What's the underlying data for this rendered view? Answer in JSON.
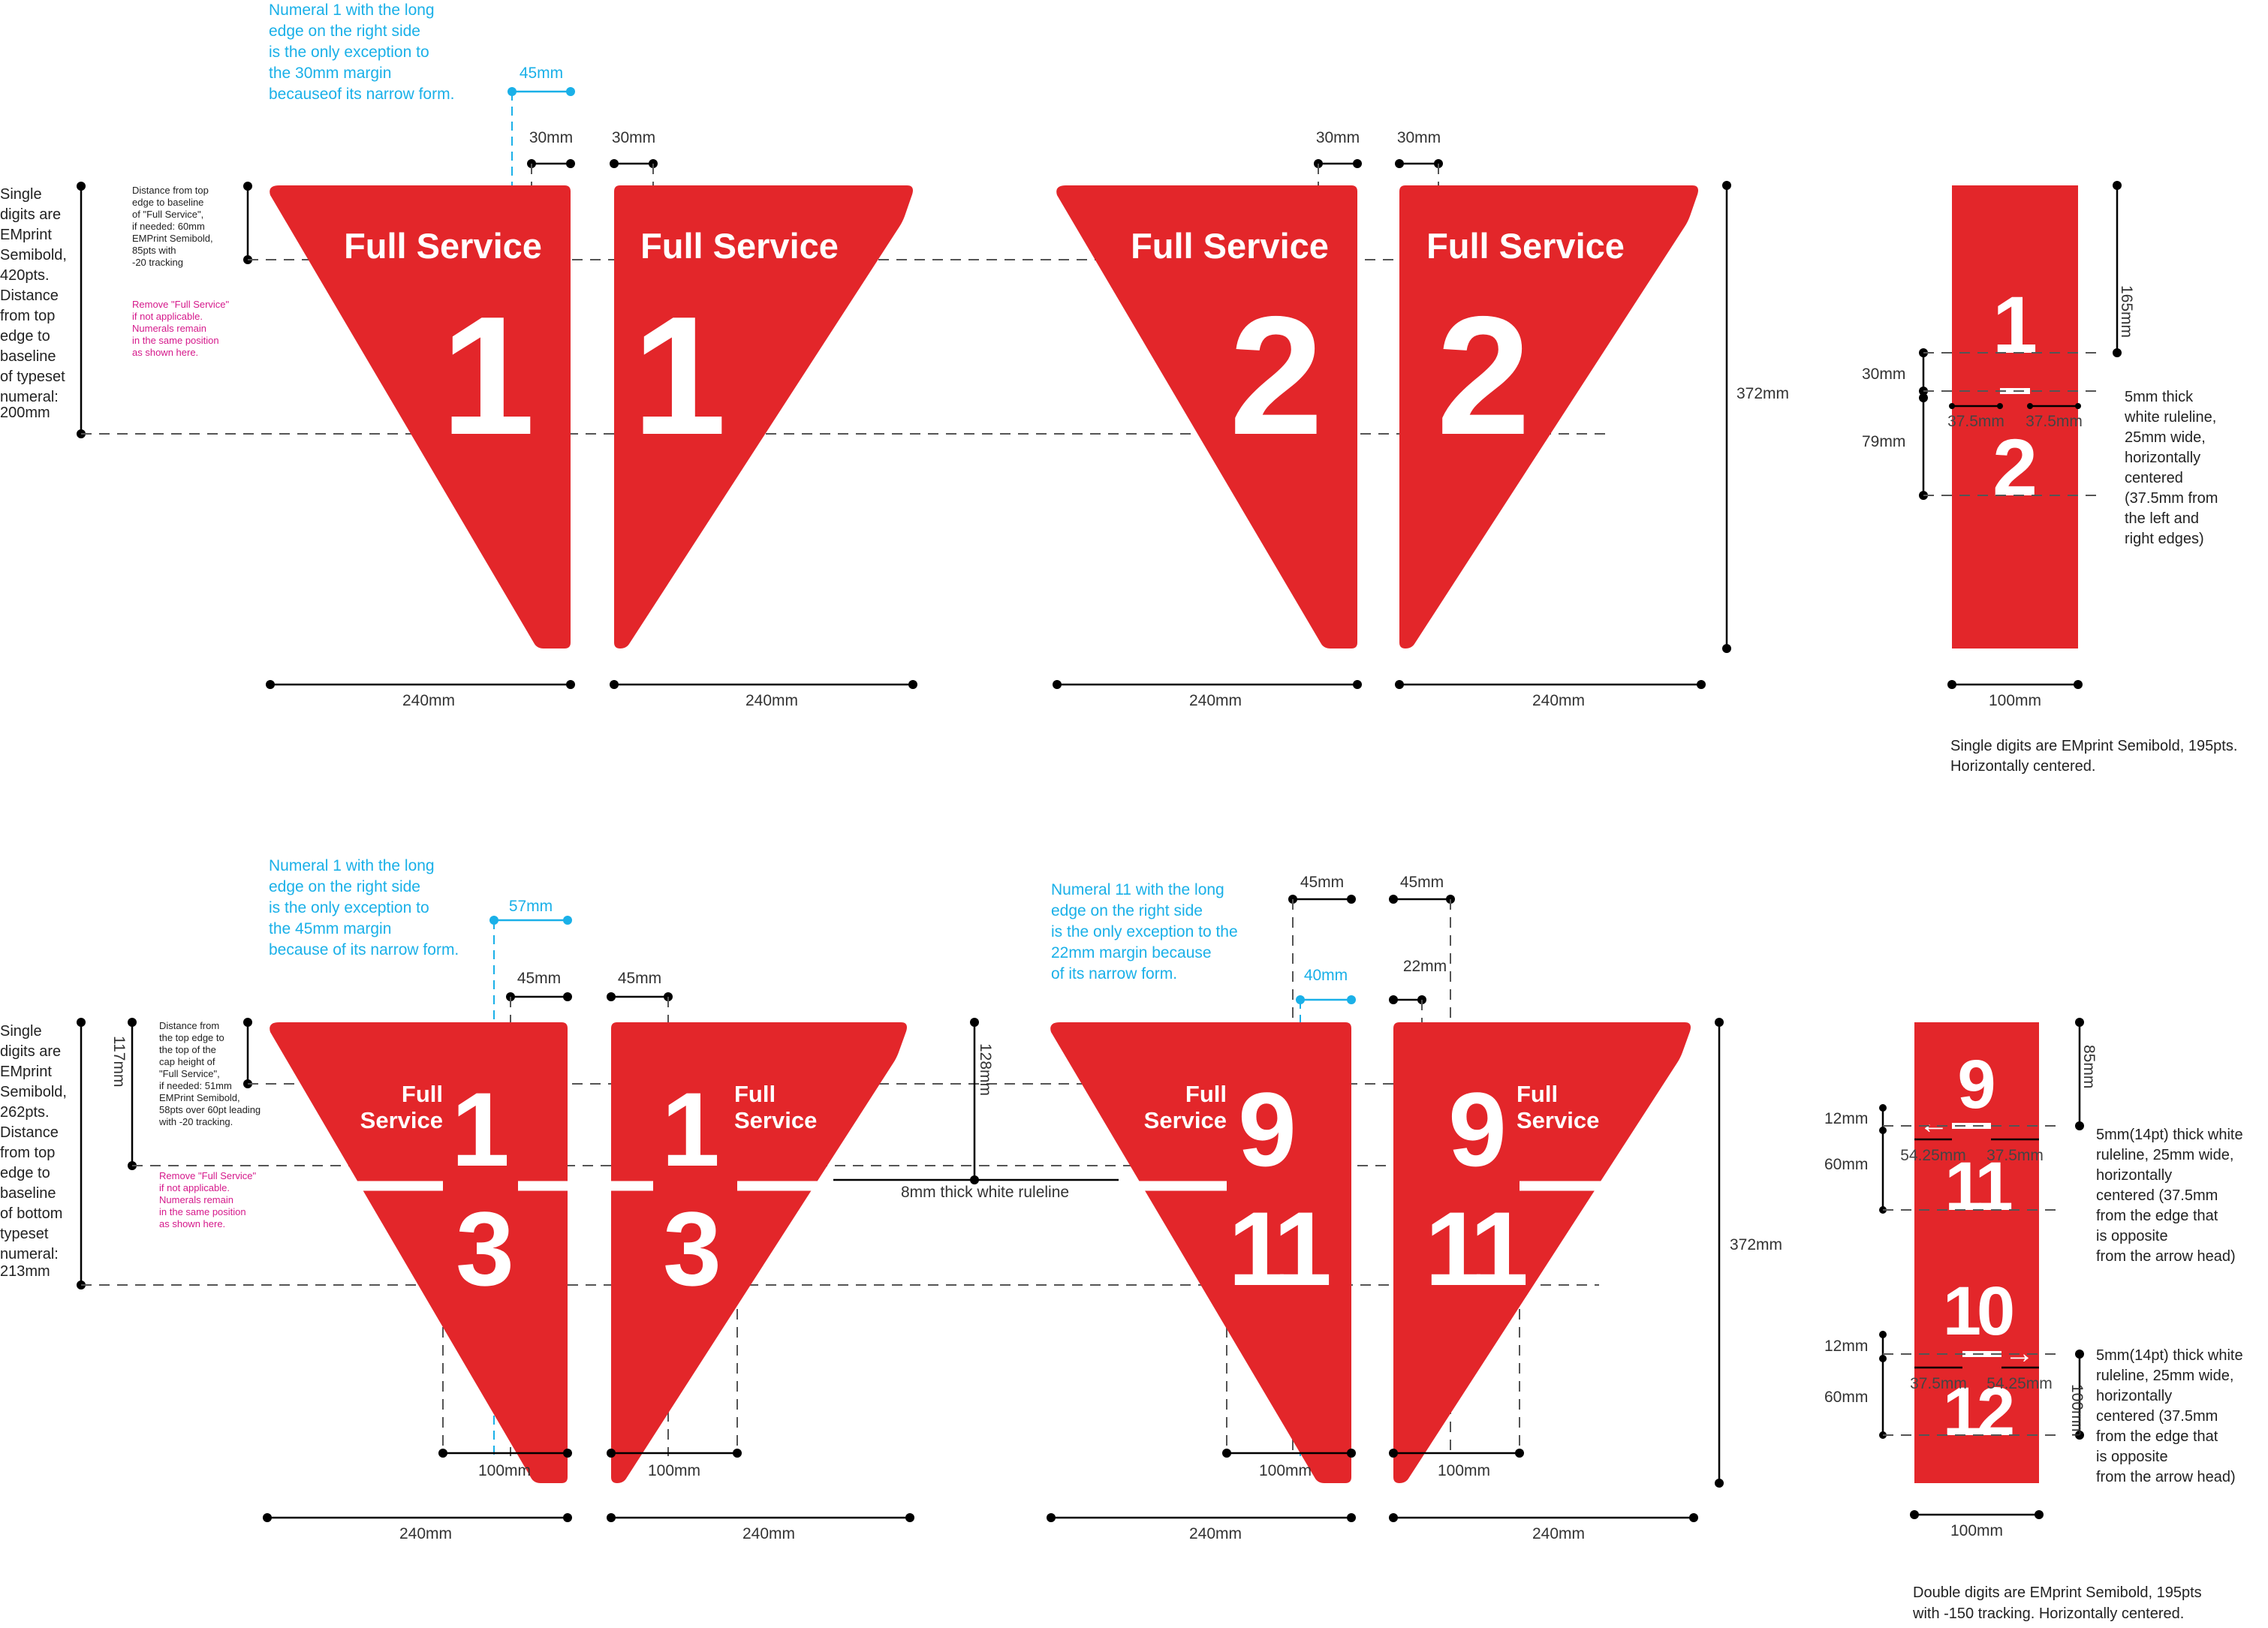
{
  "colors": {
    "sign_red": "#e3262a",
    "note_blue": "#1ab0e8",
    "note_magenta": "#d5198b",
    "dimension": "#000000"
  },
  "sign_text": "Full Service",
  "sign_text_line1": "Full",
  "sign_text_line2": "Service",
  "top": {
    "callout_exception": [
      "Numeral 1 with the long",
      "edge on the right side",
      "is the only exception to",
      "the 30mm margin",
      "becauseof its narrow form."
    ],
    "left_note": [
      "Single",
      "digits are",
      "EMprint",
      "Semibold,",
      "420pts.",
      "Distance",
      "from top",
      "edge to",
      "baseline",
      "of typeset",
      "numeral:",
      "200mm"
    ],
    "small_note": [
      "Distance from top",
      "edge to baseline",
      "of \"Full Service\",",
      "if needed: 60mm",
      "EMPrint Semibold,",
      "85pts with",
      "-20 tracking"
    ],
    "magenta_note": [
      "Remove \"Full Service\"",
      "if not applicable.",
      "Numerals remain",
      "in the same position",
      "as shown here."
    ],
    "numerals": [
      "1",
      "1",
      "2",
      "2"
    ],
    "dims": {
      "d45": "45mm",
      "d30": "30mm",
      "d240": "240mm",
      "d372": "372mm",
      "d165": "165mm",
      "d100": "100mm",
      "d79": "79mm",
      "d375": "37.5mm"
    },
    "fraction": {
      "num": "1",
      "den": "2"
    },
    "rule_note": [
      "5mm thick",
      "white ruleline,",
      "25mm wide,",
      "horizontally",
      "centered",
      "(37.5mm from",
      "the left and",
      "right edges)"
    ],
    "bottom_note": [
      "Single digits are EMprint Semibold, 195pts.",
      "Horizontally centered."
    ]
  },
  "bottom": {
    "callout_exception": [
      "Numeral 1 with the long",
      "edge on the right side",
      "is the only exception to",
      "the 45mm margin",
      "because of its narrow form."
    ],
    "callout_exception_11": [
      "Numeral 11 with the long",
      "edge on the right side",
      "is the only exception to the",
      "22mm margin because",
      "of its narrow form."
    ],
    "left_note": [
      "Single",
      "digits are",
      "EMprint",
      "Semibold,",
      "262pts.",
      "Distance",
      "from top",
      "edge to",
      "baseline",
      "of bottom",
      "typeset",
      "numeral:",
      "213mm"
    ],
    "small_note": [
      "Distance from",
      "the top edge to",
      "the top of the",
      "cap height of",
      "\"Full Service\",",
      "if needed: 51mm",
      "EMPrint Semibold,",
      "58pts over 60pt leading",
      "with -20 tracking."
    ],
    "magenta_note": [
      "Remove \"Full Service\"",
      "if not applicable.",
      "Numerals remain",
      "in the same position",
      "as shown here."
    ],
    "fractions": [
      {
        "num": "1",
        "den": "3"
      },
      {
        "num": "1",
        "den": "3"
      },
      {
        "num": "9",
        "den": "11"
      },
      {
        "num": "9",
        "den": "11"
      }
    ],
    "dims": {
      "d57": "57mm",
      "d45": "45mm",
      "d40": "40mm",
      "d22": "22mm",
      "d117": "117mm",
      "d128": "128mm",
      "d100": "100mm",
      "d240": "240mm",
      "d372": "372mm",
      "d85": "85mm",
      "d12": "12mm",
      "d60": "60mm",
      "d5425": "54.25mm",
      "d375": "37.5mm"
    },
    "ruleline_label": "8mm thick white ruleline",
    "strip_fractions": [
      {
        "num": "9",
        "den": "11",
        "arrow": "←"
      },
      {
        "num": "10",
        "den": "12",
        "arrow": "→"
      }
    ],
    "rule_note": [
      "5mm(14pt) thick white",
      "ruleline, 25mm wide,",
      "horizontally",
      "centered (37.5mm",
      "from the edge that",
      "is opposite",
      "from the arrow head)"
    ],
    "bottom_note": [
      "Double digits are EMprint Semibold, 195pts",
      "with -150 tracking. Horizontally centered."
    ]
  }
}
